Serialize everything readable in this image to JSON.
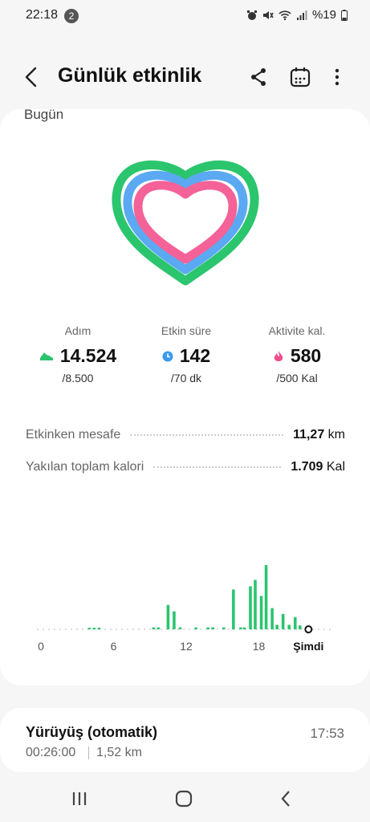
{
  "status_bar": {
    "time": "22:18",
    "notification_count": "2",
    "battery": "%19"
  },
  "header": {
    "title": "Günlük etkinlik"
  },
  "section_label": "Bugün",
  "metrics": [
    {
      "label": "Adım",
      "value": "14.524",
      "goal": "/8.500",
      "icon": "shoe-icon",
      "color": "#2bc56e"
    },
    {
      "label": "Etkin süre",
      "value": "142",
      "goal": "/70 dk",
      "icon": "clock-icon",
      "color": "#3a9af0"
    },
    {
      "label": "Aktivite kal.",
      "value": "580",
      "goal": "/500 Kal",
      "icon": "flame-icon",
      "color": "#f04d8a"
    }
  ],
  "stats": [
    {
      "label": "Etkinken mesafe",
      "value": "11,27",
      "unit": "km"
    },
    {
      "label": "Yakılan toplam kalori",
      "value": "1.709",
      "unit": "Kal"
    }
  ],
  "chart_data": {
    "type": "bar",
    "x_tick_labels": [
      "0",
      "6",
      "12",
      "18",
      "Şimdi"
    ],
    "series_color": "#2bc56e",
    "bars": [
      {
        "hour": 4.2,
        "level": 0.02
      },
      {
        "hour": 4.6,
        "level": 0.02
      },
      {
        "hour": 5.0,
        "level": 0.02
      },
      {
        "hour": 9.5,
        "level": 0.03
      },
      {
        "hour": 9.9,
        "level": 0.03
      },
      {
        "hour": 10.7,
        "level": 0.38
      },
      {
        "hour": 11.2,
        "level": 0.28
      },
      {
        "hour": 11.7,
        "level": 0.03
      },
      {
        "hour": 13.0,
        "level": 0.03
      },
      {
        "hour": 14.0,
        "level": 0.03
      },
      {
        "hour": 14.4,
        "level": 0.03
      },
      {
        "hour": 15.3,
        "level": 0.03
      },
      {
        "hour": 16.1,
        "level": 0.62
      },
      {
        "hour": 16.7,
        "level": 0.03
      },
      {
        "hour": 17.0,
        "level": 0.03
      },
      {
        "hour": 17.5,
        "level": 0.67
      },
      {
        "hour": 17.9,
        "level": 0.77
      },
      {
        "hour": 18.4,
        "level": 0.52
      },
      {
        "hour": 18.8,
        "level": 1.0
      },
      {
        "hour": 19.3,
        "level": 0.33
      },
      {
        "hour": 19.7,
        "level": 0.07
      },
      {
        "hour": 20.2,
        "level": 0.24
      },
      {
        "hour": 20.7,
        "level": 0.07
      },
      {
        "hour": 21.2,
        "level": 0.19
      },
      {
        "hour": 21.6,
        "level": 0.06
      }
    ],
    "now_hour": 22.3
  },
  "ring_levels": {
    "steps": 1.0,
    "active_time": 1.0,
    "calories": 1.0
  },
  "workout": {
    "title": "Yürüyüş (otomatik)",
    "time": "17:53",
    "duration": "00:26:00",
    "distance": "1,52 km"
  }
}
